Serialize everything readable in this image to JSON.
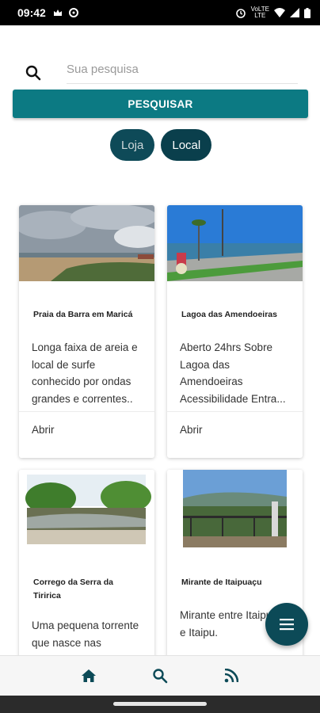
{
  "status_bar": {
    "time": "09:42",
    "lte_top": "VoLTE",
    "lte_bottom": "LTE"
  },
  "search": {
    "placeholder": "Sua pesquisa",
    "button_label": "PESQUISAR"
  },
  "filters": [
    {
      "label": "Loja"
    },
    {
      "label": "Local"
    }
  ],
  "cards": [
    {
      "title": "Praia da Barra em Maricá",
      "description": "Longa faixa de areia e local de surfe conhecido por ondas grandes e correntes..",
      "action": "Abrir"
    },
    {
      "title": "Lagoa das Amendoeiras",
      "description": "Aberto 24hrs Sobre Lagoa das Amendoeiras Acessibilidade Entra...",
      "action": "Abrir"
    },
    {
      "title": "Corrego da Serra da Tiririca",
      "description": "Uma pequena torrente que nasce nas"
    },
    {
      "title": "Mirante de Itaipuaçu",
      "description": "Mirante entre Itaipuaçu e Itaipu."
    }
  ],
  "colors": {
    "accent": "#0c7a83",
    "chip": "#0e4a58",
    "fab": "#0c4a57",
    "nav_icon": "#0c4a57"
  },
  "icons": {
    "search": "search-icon",
    "fab": "menu-icon",
    "nav": [
      "home-icon",
      "search-icon",
      "rss-icon"
    ]
  }
}
